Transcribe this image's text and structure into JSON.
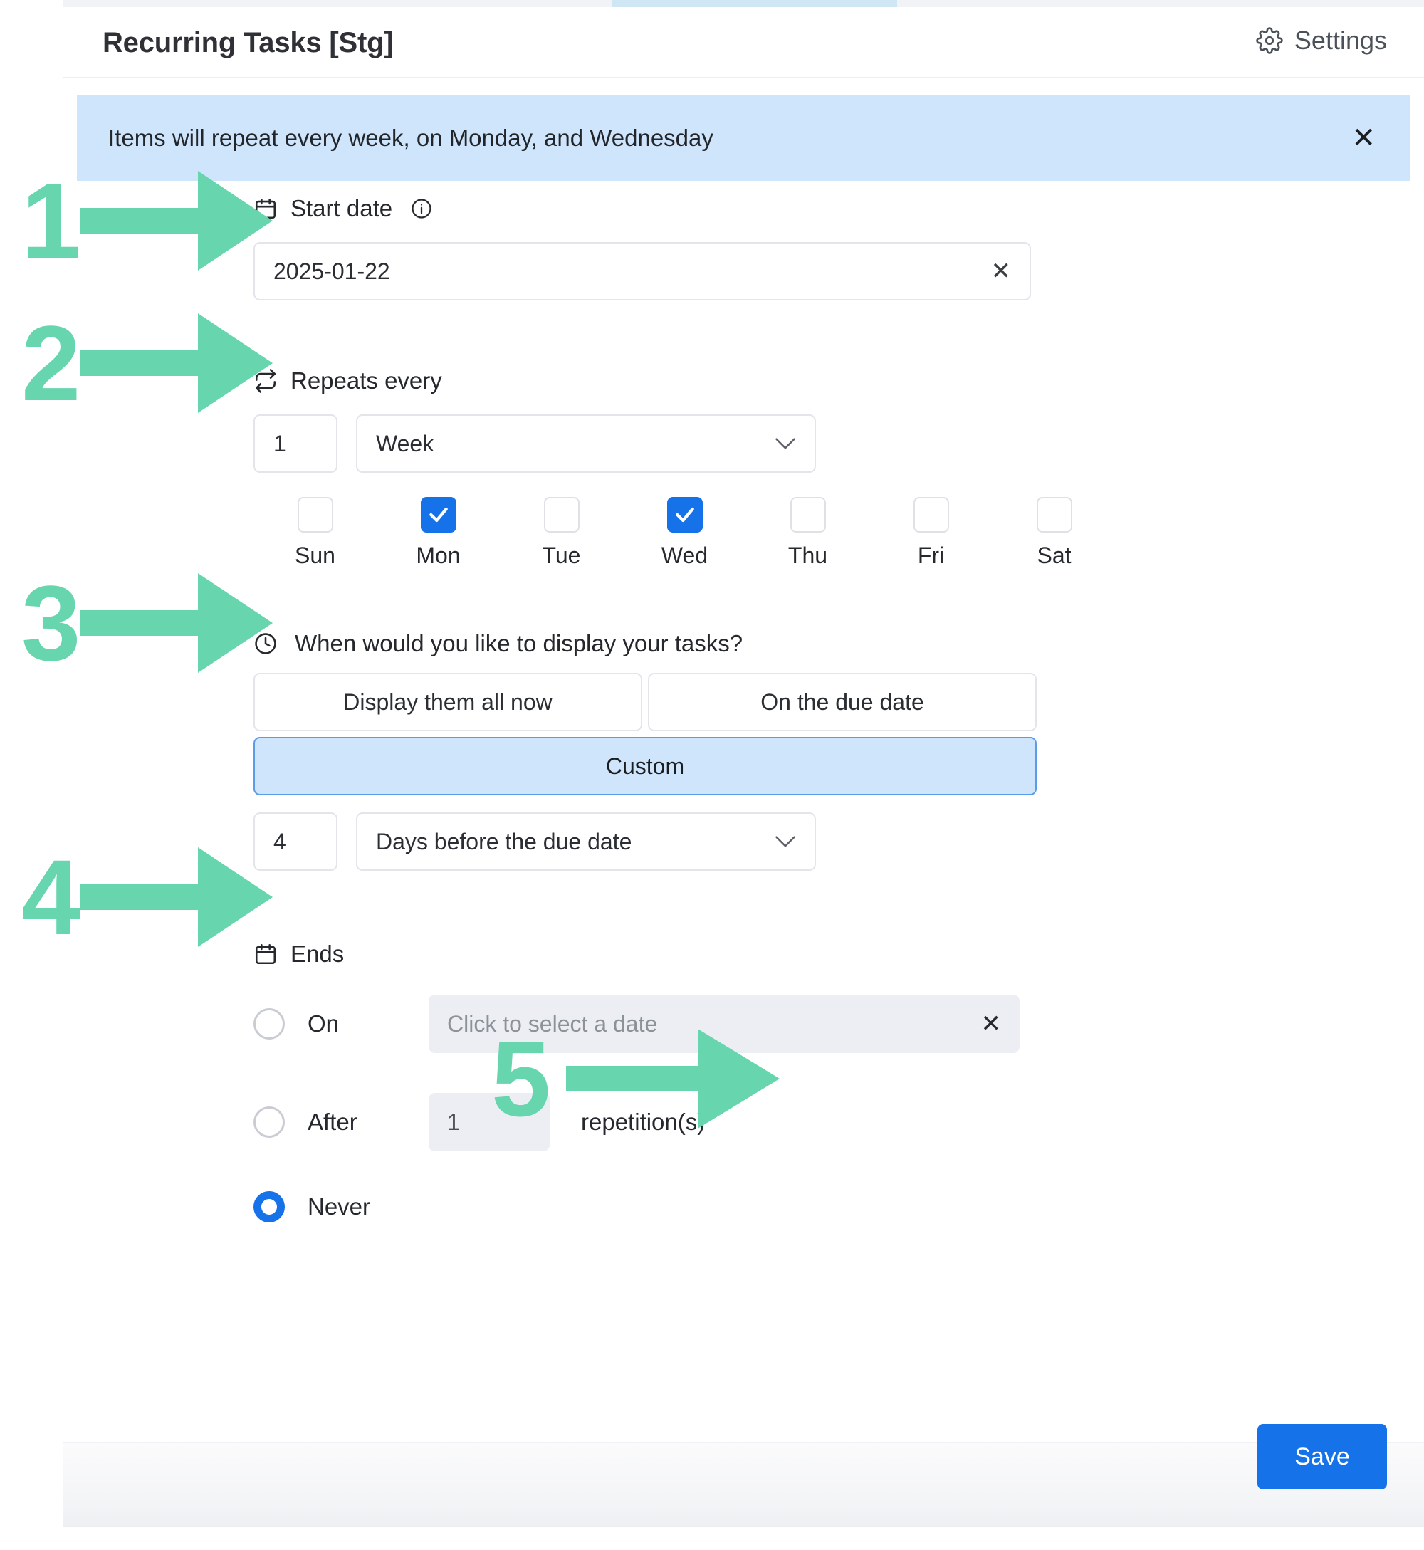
{
  "window": {
    "title": "Recurring Tasks [Stg]",
    "settings_label": "Settings",
    "settings_icon": "gear-icon"
  },
  "banner": {
    "message": "Items will repeat every week, on Monday, and Wednesday",
    "close_icon": "close-icon",
    "background_color": "#cfe5fb"
  },
  "form": {
    "start_date": {
      "label": "Start date",
      "icon": "calendar-icon",
      "info_icon": "info-circle-icon",
      "value": "2025-01-22",
      "clear_icon": "close-icon"
    },
    "repeats_every": {
      "label": "Repeats every",
      "icon": "repeat-icon",
      "interval_value": "1",
      "unit_value": "Week",
      "chevron_icon": "chevron-down-icon",
      "days": [
        {
          "label": "Sun",
          "checked": false
        },
        {
          "label": "Mon",
          "checked": true
        },
        {
          "label": "Tue",
          "checked": false
        },
        {
          "label": "Wed",
          "checked": true
        },
        {
          "label": "Thu",
          "checked": false
        },
        {
          "label": "Fri",
          "checked": false
        },
        {
          "label": "Sat",
          "checked": false
        }
      ]
    },
    "display_timing": {
      "label": "When would you like to display your tasks?",
      "icon": "clock-icon",
      "options": [
        {
          "label": "Display them all now",
          "selected": false
        },
        {
          "label": "On the due date",
          "selected": false
        },
        {
          "label": "Custom",
          "selected": true
        }
      ],
      "custom_offset_value": "4",
      "custom_offset_unit": "Days before the due date",
      "chevron_icon": "chevron-down-icon"
    },
    "ends": {
      "label": "Ends",
      "icon": "calendar-icon",
      "on": {
        "label": "On",
        "selected": false,
        "date_placeholder": "Click to select a date",
        "clear_icon": "close-icon"
      },
      "after": {
        "label": "After",
        "selected": false,
        "value": "1",
        "suffix": "repetition(s)"
      },
      "never": {
        "label": "Never",
        "selected": true
      }
    }
  },
  "footer": {
    "save_label": "Save",
    "save_color": "#1572e8"
  },
  "annotations": {
    "color": "#67d5ae",
    "steps": [
      {
        "number": "1",
        "target": "start-date-input"
      },
      {
        "number": "2",
        "target": "repeats-every-controls"
      },
      {
        "number": "3",
        "target": "custom-display-option"
      },
      {
        "number": "4",
        "target": "ends-after-option"
      },
      {
        "number": "5",
        "target": "save-button"
      }
    ]
  }
}
